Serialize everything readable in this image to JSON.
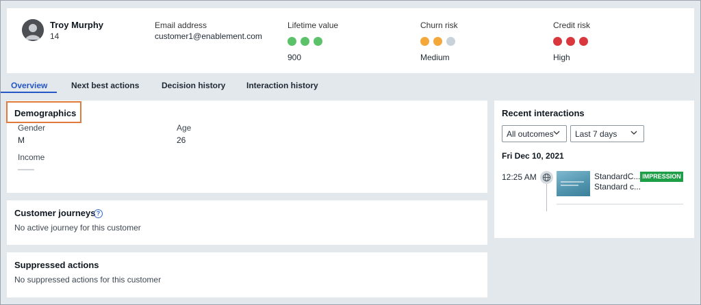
{
  "customer": {
    "name": "Troy Murphy",
    "id": "14",
    "email_label": "Email address",
    "email": "customer1@enablement.com"
  },
  "metrics": {
    "lifetime": {
      "label": "Lifetime value",
      "value": "900",
      "dot_colors": [
        "#5cc26a",
        "#5cc26a",
        "#5cc26a"
      ]
    },
    "churn": {
      "label": "Churn risk",
      "value": "Medium",
      "dot_colors": [
        "#f5a83a",
        "#f5a83a",
        "#c9d1d9"
      ]
    },
    "credit": {
      "label": "Credit risk",
      "value": "High",
      "dot_colors": [
        "#d9363e",
        "#d9363e",
        "#d9363e"
      ]
    }
  },
  "tabs": [
    {
      "label": "Overview",
      "active": true
    },
    {
      "label": "Next best actions",
      "active": false
    },
    {
      "label": "Decision history",
      "active": false
    },
    {
      "label": "Interaction history",
      "active": false
    }
  ],
  "demographics": {
    "title": "Demographics",
    "gender_label": "Gender",
    "gender": "M",
    "age_label": "Age",
    "age": "26",
    "income_label": "Income",
    "income": "——"
  },
  "journeys": {
    "title": "Customer journeys",
    "empty": "No active journey for this customer"
  },
  "suppressed": {
    "title": "Suppressed actions",
    "empty": "No suppressed actions for this customer"
  },
  "recent": {
    "title": "Recent interactions",
    "outcome_filter": "All outcomes",
    "period_filter": "Last 7 days",
    "date": "Fri Dec 10, 2021",
    "items": [
      {
        "time": "12:25 AM",
        "title": "StandardC...",
        "subtitle": "Standard c...",
        "badge": "IMPRESSION",
        "channel_icon": "globe-icon"
      }
    ]
  },
  "colors": {
    "accent": "#2457c5",
    "highlight": "#e07a3a",
    "impression_badge": "#1f9e48",
    "background": "#e3e8ed"
  }
}
